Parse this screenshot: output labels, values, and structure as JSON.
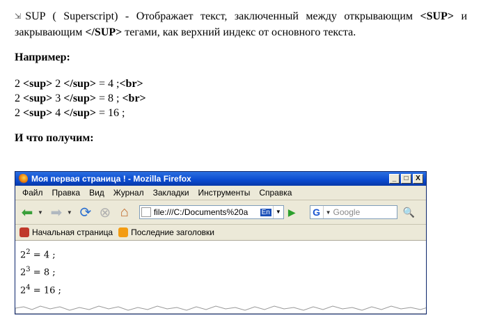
{
  "doc": {
    "arrow_icon": "link-arrow-icon",
    "intro_tag": "SUP",
    "intro_1": " ( Superscript) - Отображает текст, заключенный между открывающим ",
    "open_tag": "<SUP>",
    "intro_2": " и закрывающим ",
    "close_tag": "</SUP>",
    "intro_3": " тегами, как верхний индекс от основного текста.",
    "example_heading": "Например:",
    "code_lines": [
      {
        "base": "2 ",
        "open": "<sup>",
        "exp": " 2 ",
        "close": "</sup>",
        "rest": " = 4 ;",
        "br": "<br>"
      },
      {
        "base": "2 ",
        "open": "<sup>",
        "exp": " 3 ",
        "close": "</sup>",
        "rest": " = 8 ; ",
        "br": "<br>"
      },
      {
        "base": "2 ",
        "open": "<sup>",
        "exp": " 4 ",
        "close": "</sup>",
        "rest": " = 16 ;",
        "br": ""
      }
    ],
    "result_heading": "И что получим:"
  },
  "browser": {
    "title": "Моя первая страница ! - Mozilla Firefox",
    "window_buttons": [
      "_",
      "□",
      "X"
    ],
    "menu": [
      "Файл",
      "Правка",
      "Вид",
      "Журнал",
      "Закладки",
      "Инструменты",
      "Справка"
    ],
    "url": "file:///C:/Documents%20a",
    "url_lang": "En",
    "search_engine": "G",
    "search_placeholder": "Google",
    "bookmarks": [
      {
        "label": "Начальная страница",
        "icon": "firefox-home-icon",
        "color": "#c0392b"
      },
      {
        "label": "Последние заголовки",
        "icon": "rss-feed-icon",
        "color": "#f39c12"
      }
    ],
    "result_lines": [
      {
        "base": "2",
        "sup": "2",
        "rest": " = 4 ;"
      },
      {
        "base": "2",
        "sup": "3",
        "rest": " = 8 ;"
      },
      {
        "base": "2",
        "sup": "4",
        "rest": " = 16 ;"
      }
    ]
  },
  "colors": {
    "titlebar": "#0a4ad0",
    "chrome": "#ece9d8",
    "accent": "#1a55d0"
  }
}
